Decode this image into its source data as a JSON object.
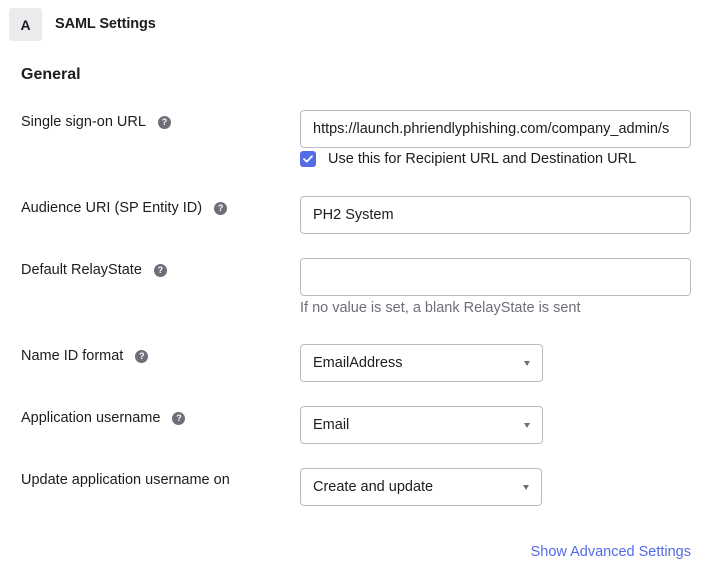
{
  "header": {
    "step": "A",
    "title": "SAML Settings"
  },
  "section": {
    "title": "General"
  },
  "fields": {
    "sso_url": {
      "label": "Single sign-on URL",
      "value": "https://launch.phriendlyphishing.com/company_admin/s",
      "checkbox_label": "Use this for Recipient URL and Destination URL",
      "checkbox_checked": true
    },
    "audience_uri": {
      "label": "Audience URI (SP Entity ID)",
      "value": "PH2 System"
    },
    "relay_state": {
      "label": "Default RelayState",
      "value": "",
      "hint": "If no value is set, a blank RelayState is sent"
    },
    "name_id_format": {
      "label": "Name ID format",
      "selected": "EmailAddress"
    },
    "app_username": {
      "label": "Application username",
      "selected": "Email"
    },
    "update_username_on": {
      "label": "Update application username on",
      "selected": "Create and update"
    }
  },
  "advanced_link": "Show Advanced Settings",
  "icons": {
    "help": "question-circle-icon",
    "check": "checkmark-icon",
    "caret": "caret-down-icon"
  },
  "colors": {
    "accent": "#546be7",
    "border": "#b7bcc5",
    "muted_text": "#6e6e78",
    "badge_bg": "#ebebed"
  }
}
